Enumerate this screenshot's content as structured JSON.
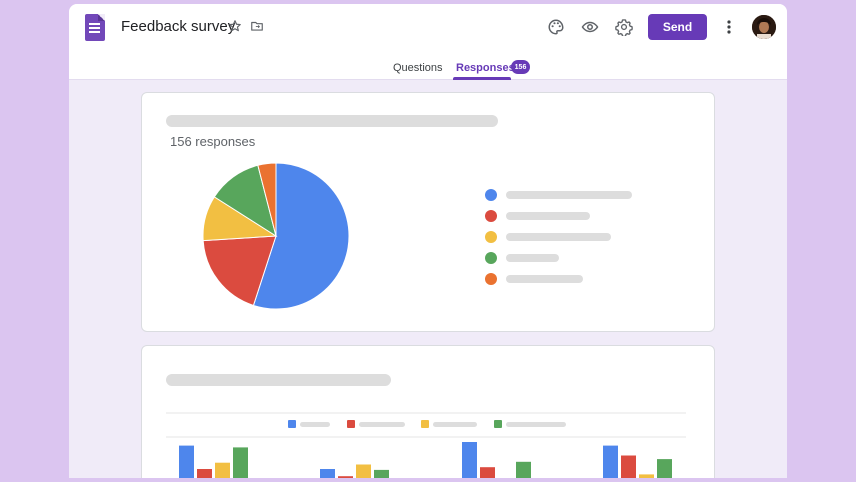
{
  "app": {
    "title": "Feedback survey",
    "send_label": "Send"
  },
  "tabs": [
    {
      "label": "Questions",
      "active": false
    },
    {
      "label": "Responses",
      "active": true,
      "badge": "156"
    }
  ],
  "colors": {
    "accent": "#673ab7",
    "blue": "#4e86ec",
    "red": "#db4b3f",
    "yellow": "#f2bf42",
    "green": "#58a65c",
    "orange": "#ea7230"
  },
  "summary": {
    "responses_text": "156 responses"
  },
  "chart_data": [
    {
      "type": "pie",
      "values": [
        55,
        19,
        10,
        12,
        4
      ]
    },
    {
      "type": "bar",
      "categories": [
        "",
        "",
        "",
        ""
      ],
      "series": [
        {
          "values": [
            36,
            10,
            40,
            36
          ]
        },
        {
          "values": [
            10,
            2,
            12,
            25
          ]
        },
        {
          "values": [
            17,
            15,
            0,
            4
          ]
        },
        {
          "values": [
            34,
            9,
            18,
            21
          ]
        }
      ],
      "ylim": [
        0,
        40
      ]
    }
  ]
}
